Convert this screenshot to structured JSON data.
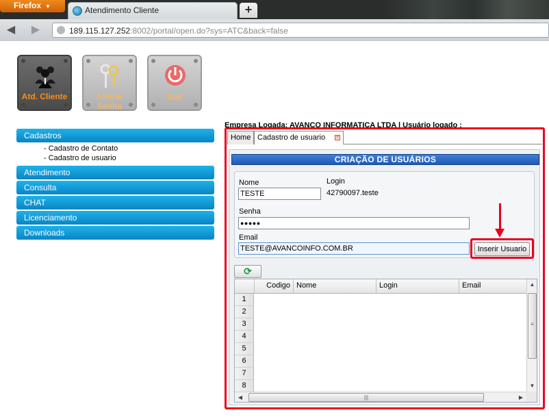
{
  "browser": {
    "app_button": "Firefox",
    "tab_title": "Atendimento Cliente",
    "new_tab": "+",
    "url_host": "189.115.127.252",
    "url_rest": ":8002/portal/open.do?sys=ATC&back=false"
  },
  "app_buttons": [
    {
      "label": "Atd. Cliente"
    },
    {
      "label": "Alterar Senha"
    },
    {
      "label": "Sair"
    }
  ],
  "menu": {
    "sections": [
      {
        "label": "Cadastros",
        "items": [
          "- Cadastro de Contato",
          "- Cadastro de usuario"
        ]
      },
      {
        "label": "Atendimento"
      },
      {
        "label": "Consulta"
      },
      {
        "label": "CHAT"
      },
      {
        "label": "Licenciamento"
      },
      {
        "label": "Downloads"
      }
    ]
  },
  "header": {
    "empresa": "Empresa Logada: AVANCO INFORMATICA LTDA | Usuário logado :"
  },
  "tabs": [
    "Home",
    "Cadastro de usuario"
  ],
  "form": {
    "title": "CRIAÇÃO DE USUÁRIOS",
    "nome_label": "Nome",
    "nome_value": "TESTE",
    "login_label": "Login",
    "login_value": "42790097.teste",
    "senha_label": "Senha",
    "senha_value": "●●●●●",
    "email_label": "Email",
    "email_value": "TESTE@AVANCOINFO.COM.BR",
    "insert_button": "Inserir Usuario"
  },
  "grid": {
    "columns": [
      "Codigo",
      "Nome",
      "Login",
      "Email"
    ],
    "row_numbers": [
      "1",
      "2",
      "3",
      "4",
      "5",
      "6",
      "7",
      "8"
    ]
  },
  "colors": {
    "menu_blue": "#0a8fcf",
    "highlight_red": "#e8001c",
    "title_blue": "#1f5bb8",
    "accent_orange": "#ff8c1a"
  }
}
